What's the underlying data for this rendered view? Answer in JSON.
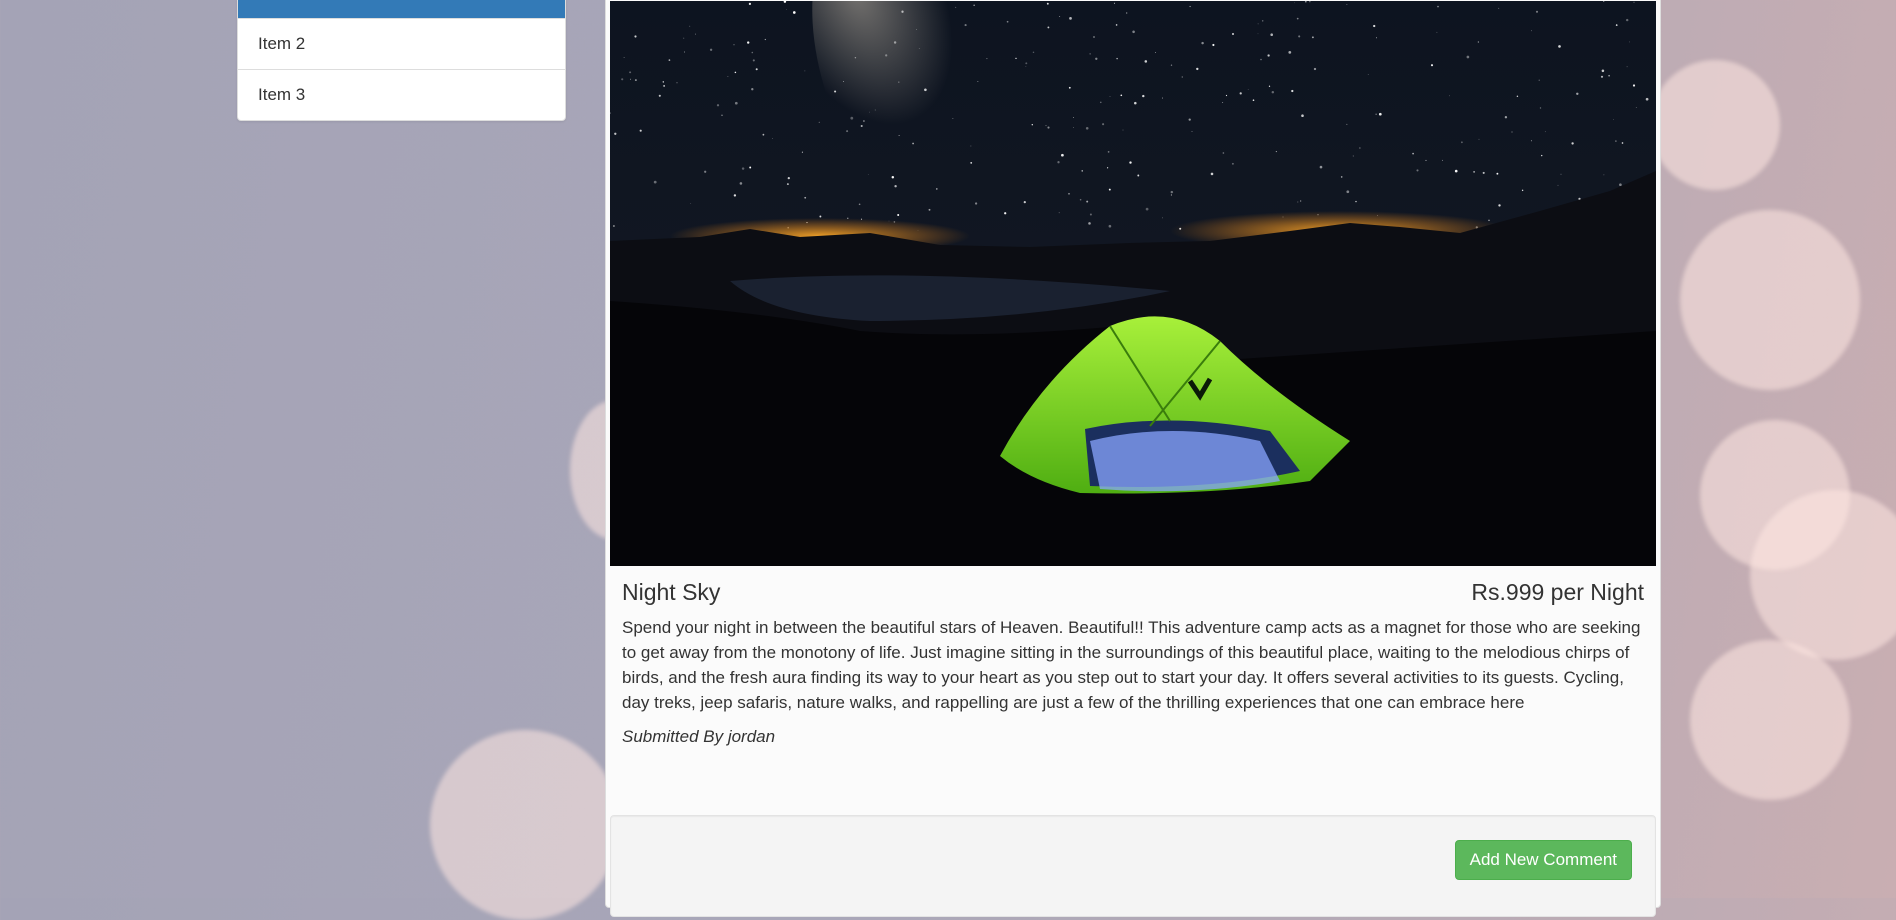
{
  "sidebar": {
    "items": [
      {
        "label": ""
      },
      {
        "label": "Item 2"
      },
      {
        "label": "Item 3"
      }
    ],
    "active_color": "#337ab7"
  },
  "campground": {
    "name": "Night Sky",
    "price": "Rs.999 per Night",
    "description": "Spend your night in between the beautiful stars of Heaven. Beautiful!! This adventure camp acts as a magnet for those who are seeking to get away from the monotony of life. Just imagine sitting in the surroundings of this beautiful place, waiting to the melodious chirps of birds, and the fresh aura finding its way to your heart as you step out to start your day. It offers several activities to its guests. Cycling, day treks, jeep safaris, nature walks, and rappelling are just a few of the thrilling experiences that one can embrace here",
    "submitted_by": "Submitted By jordan",
    "image_alt": "Green tent under the milky way at night"
  },
  "comments": {
    "add_button_label": "Add New Comment",
    "button_color": "#5cb85c"
  }
}
